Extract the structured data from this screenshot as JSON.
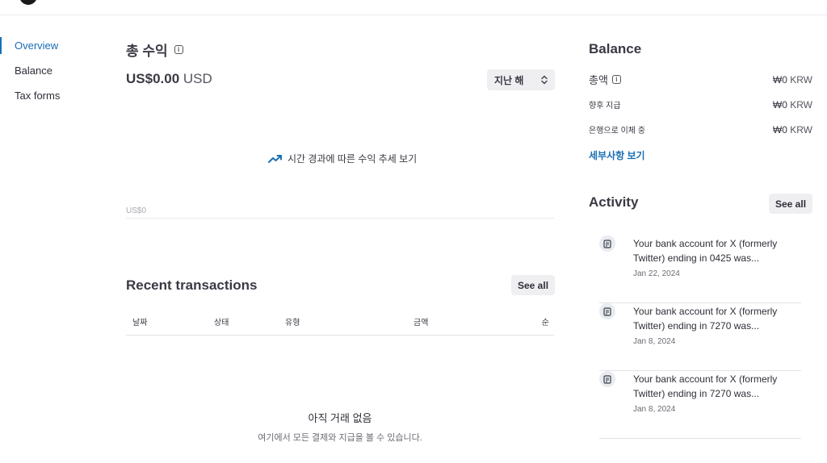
{
  "sidebar": {
    "items": [
      {
        "label": "Overview",
        "active": true
      },
      {
        "label": "Balance",
        "active": false
      },
      {
        "label": "Tax forms",
        "active": false
      }
    ]
  },
  "earnings": {
    "title": "총 수익",
    "amount": "US$0.00",
    "currency": "USD",
    "range_label": "지난 해",
    "trend_link": "시간 경과에 따른 수익 추세 보기",
    "axis_label": "US$0"
  },
  "transactions": {
    "title": "Recent transactions",
    "see_all": "See all",
    "columns": [
      "날짜",
      "상태",
      "유형",
      "금액",
      "순"
    ],
    "empty_title": "아직 거래 없음",
    "empty_subtitle": "여기에서 모든 결제와 지급을 볼 수 있습니다."
  },
  "balance": {
    "title": "Balance",
    "rows": [
      {
        "label": "총액",
        "amount": "₩0",
        "currency": "KRW"
      },
      {
        "label": "향후 지급",
        "amount": "₩0",
        "currency": "KRW"
      },
      {
        "label": "은행으로 이체 중",
        "amount": "₩0",
        "currency": "KRW"
      }
    ],
    "details_link": "세부사항 보기"
  },
  "activity": {
    "title": "Activity",
    "see_all": "See all",
    "items": [
      {
        "text": "Your bank account for X (formerly Twitter) ending in 0425 was...",
        "date": "Jan 22, 2024"
      },
      {
        "text": "Your bank account for X (formerly Twitter) ending in 7270 was...",
        "date": "Jan 8, 2024"
      },
      {
        "text": "Your bank account for X (formerly Twitter) ending in 7270 was...",
        "date": "Jan 8, 2024"
      }
    ]
  },
  "colors": {
    "accent": "#1a6fb5",
    "text": "#3a3a44",
    "button_bg": "#efeff2"
  }
}
